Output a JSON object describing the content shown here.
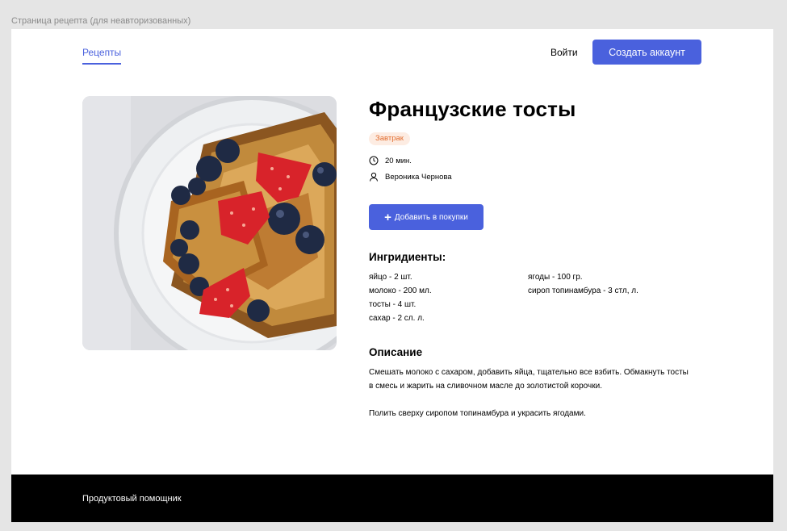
{
  "frame_label": "Страница рецепта (для неавторизованных)",
  "header": {
    "nav_recipes": "Рецепты",
    "login": "Войти",
    "create_account": "Создать аккаунт"
  },
  "recipe": {
    "title": "Французские тосты",
    "tag": "Завтрак",
    "time": "20 мин.",
    "author": "Вероника Чернова",
    "add_to_cart": "Добавить в покупки",
    "ingredients_heading": "Ингридиенты:",
    "ingredients_col1": [
      "яйцо - 2 шт.",
      "молоко - 200 мл.",
      "тосты - 4 шт.",
      "сахар - 2 сл. л."
    ],
    "ingredients_col2": [
      "ягоды - 100 гр.",
      "сироп топинамбура - 3 стл, л."
    ],
    "description_heading": "Описание",
    "description_paragraphs": [
      "Смешать молоко с сахаром, добавить яйца, тщательно все взбить. Обмакнуть тосты в смесь и жарить на сливочном масле до золотистой корочки.",
      "Полить сверху сиропом топинамбура и украсить ягодами."
    ]
  },
  "footer": {
    "text": "Продуктовый помощник"
  },
  "colors": {
    "accent": "#4a61dd",
    "tag_bg": "#fdece2",
    "tag_text": "#e26c2d",
    "footer_bg": "#000000"
  },
  "icons": [
    "clock-icon",
    "user-icon",
    "plus-icon"
  ]
}
